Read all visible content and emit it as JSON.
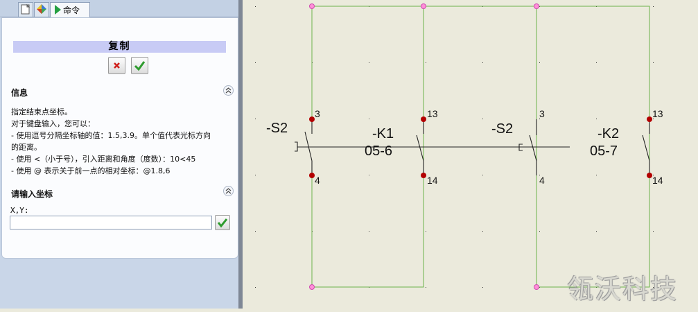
{
  "tabs": {
    "command_label": "命令"
  },
  "panel": {
    "title": "复制",
    "info": {
      "heading": "信息",
      "lines": [
        "指定结束点坐标。",
        "对于键盘输入，您可以：",
        "- 使用逗号分隔坐标轴的值：1.5,3.9。单个值代表光标方向",
        "的距离。",
        "- 使用 <（小于号），引入距离和角度（度数）：10<45",
        "- 使用 @ 表示关于前一点的相对坐标：@1.8,6"
      ]
    },
    "coords": {
      "heading": "请输入坐标",
      "label": "X,Y:",
      "value": ""
    }
  },
  "canvas": {
    "labels": [
      {
        "id": "s2-left",
        "text": "-S2"
      },
      {
        "id": "k1",
        "text": "-K1"
      },
      {
        "id": "k1-ref",
        "text": "05-6"
      },
      {
        "id": "s2-right",
        "text": "-S2"
      },
      {
        "id": "k2",
        "text": "-K2"
      },
      {
        "id": "k2-ref",
        "text": "05-7"
      }
    ],
    "pins": {
      "p3a": "3",
      "p4a": "4",
      "p13a": "13",
      "p14a": "14",
      "p3b": "3",
      "p4b": "4",
      "p13b": "13",
      "p14b": "14"
    }
  },
  "watermark": "瓴沃科技",
  "colors": {
    "wire": "#6bb34a",
    "terminal": "#b30000",
    "junction": "#ff66cc",
    "canvas": "#ebeadc"
  }
}
